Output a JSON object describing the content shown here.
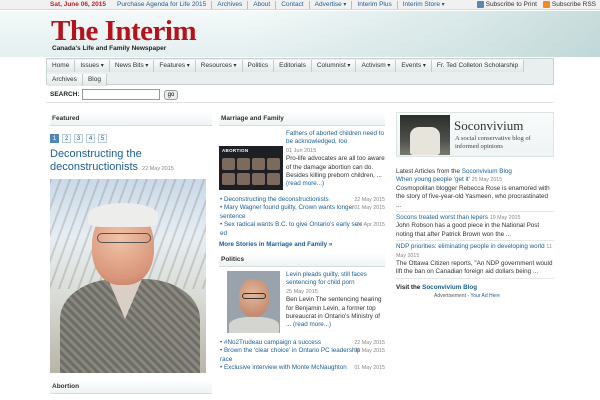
{
  "topbar": {
    "date": "Sat, June 06, 2015",
    "links": [
      "Purchase Agenda for Life 2015",
      "Archives",
      "About",
      "Contact",
      "Advertise",
      "Interim Plus",
      "Interim Store"
    ],
    "subscribe_print": "Subscribe to Print",
    "subscribe_rss": "Subscribe RSS"
  },
  "masthead": {
    "logo": "The Interim",
    "tagline": "Canada's Life and Family Newspaper"
  },
  "nav": {
    "row1": [
      {
        "label": "Home",
        "dropdown": false
      },
      {
        "label": "Issues",
        "dropdown": true
      },
      {
        "label": "News Bits",
        "dropdown": true
      },
      {
        "label": "Features",
        "dropdown": true
      },
      {
        "label": "Resources",
        "dropdown": true
      },
      {
        "label": "Politics",
        "dropdown": false
      },
      {
        "label": "Editorials",
        "dropdown": false
      },
      {
        "label": "Columnist",
        "dropdown": true
      },
      {
        "label": "Activism",
        "dropdown": true
      },
      {
        "label": "Events",
        "dropdown": true
      },
      {
        "label": "Fr. Ted Colleton Scholarship",
        "dropdown": false
      }
    ],
    "row2": [
      {
        "label": "Archives",
        "dropdown": false
      },
      {
        "label": "Blog",
        "dropdown": false
      }
    ]
  },
  "search": {
    "label": "SEARCH:",
    "value": "",
    "button": "go"
  },
  "featured": {
    "heading": "Featured",
    "pages": [
      "1",
      "2",
      "3",
      "4",
      "5"
    ],
    "active_page": "1",
    "title": "Deconstructing the deconstructionists",
    "date": "22 May 2015",
    "next_heading": "Abortion"
  },
  "marriage": {
    "heading": "Marriage and Family",
    "thumb_title": "ABORTION",
    "lead": {
      "title": "Fathers of aborted children need to be acknowledged, too",
      "date": "01 Jun 2015",
      "excerpt": "Pro-life advocates are all too aware of the damage abortion can do. Besides killing preborn children, ...",
      "more": "(read more...)"
    },
    "items": [
      {
        "title": "Deconstructing the deconstructionists",
        "date": "22 May 2015"
      },
      {
        "title": "Mary Wagner found guilty, Crown wants longer sentence",
        "date": "01 May 2015"
      },
      {
        "title": "Sex radical wants B.C. to give Ontario's early sex ed",
        "date": "24 Apr 2015"
      }
    ],
    "more_link": "More Stories in Marriage and Family »"
  },
  "politics": {
    "heading": "Politics",
    "lead": {
      "title": "Levin pleads guilty, still faces sentencing for child porn",
      "date": "25 May 2015",
      "excerpt": "Ben Levin The sentencing hearing for Benjamin Levin, a former top bureaucrat in Ontario's Ministry of ...",
      "more": "(read more...)"
    },
    "items": [
      {
        "title": "#No2Trudeau campaign a success",
        "date": "22 May 2015"
      },
      {
        "title": "Brown the 'clear choice' in Ontario PC leadership race",
        "date": "01 May 2015"
      },
      {
        "title": "Exclusive interview with Monte McNaughton",
        "date": "01 May 2015"
      }
    ]
  },
  "blog": {
    "name": "Soconvivium",
    "description": "A social conservative blog of informed opinions",
    "latest_prefix": "Latest Articles from the ",
    "latest_link": "Soconvivium Blog",
    "items": [
      {
        "title": "When young people 'get it'",
        "date": "25 May 2015",
        "excerpt": "Cosmopolitan blogger Rebecca Rose is enamored with the story of five-year-old Yasmeen, who procrastinated ..."
      },
      {
        "title": "Socons treated worst than lepers",
        "date": "19 May 2015",
        "excerpt": "John Robson has a good piece in the National Post noting that after Patrick Brown won the ..."
      },
      {
        "title": "NDP priorities: eliminating people in developing world",
        "date": "11 May 2015",
        "excerpt": "The Ottawa Citizen reports, \"An NDP government would lift the ban on Canadian foreign aid dollars being ..."
      }
    ],
    "visit_prefix": "Visit the ",
    "visit_link": "Soconvivium Blog",
    "advert_prefix": "Advertisement - ",
    "advert_link": "Your Ad Here"
  }
}
